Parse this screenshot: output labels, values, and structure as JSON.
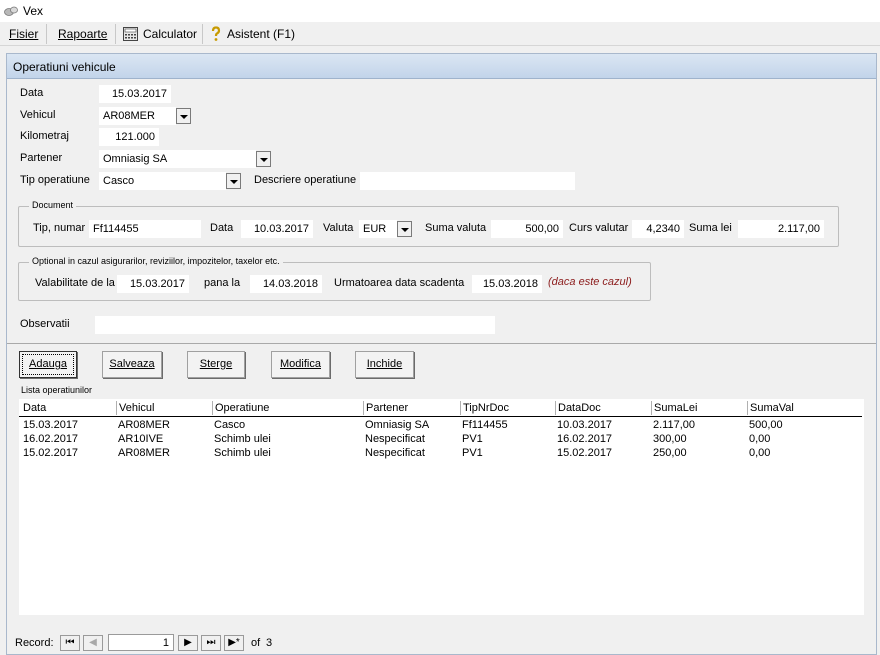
{
  "window": {
    "title": "Vex"
  },
  "menu": {
    "fisier": "Fisier",
    "rapoarte": "Rapoarte",
    "calculator": "Calculator",
    "asistent": "Asistent (F1)"
  },
  "form": {
    "title": "Operatiuni vehicule",
    "data_label": "Data",
    "data_value": "15.03.2017",
    "vehicul_label": "Vehicul",
    "vehicul_value": "AR08MER",
    "kilometraj_label": "Kilometraj",
    "kilometraj_value": "121.000",
    "partener_label": "Partener",
    "partener_value": "Omniasig SA",
    "tip_op_label": "Tip operatiune",
    "tip_op_value": "Casco",
    "descriere_label": "Descriere operatiune",
    "descriere_value": "",
    "observatii_label": "Observatii",
    "observatii_value": ""
  },
  "document": {
    "title": "Document",
    "tip_numar_label": "Tip, numar",
    "tip_numar_value": "Ff114455",
    "data_label": "Data",
    "data_value": "10.03.2017",
    "valuta_label": "Valuta",
    "valuta_value": "EUR",
    "suma_valuta_label": "Suma valuta",
    "suma_valuta_value": "500,00",
    "curs_label": "Curs valutar",
    "curs_value": "4,2340",
    "suma_lei_label": "Suma lei",
    "suma_lei_value": "2.117,00"
  },
  "optional": {
    "title": "Optional in cazul asigurarilor, reviziilor, impozitelor, taxelor etc.",
    "valabil_label": "Valabilitate de la",
    "valabil_value": "15.03.2017",
    "pana_label": "pana la",
    "pana_value": "14.03.2018",
    "scadenta_label": "Urmatoarea data scadenta",
    "scadenta_value": "15.03.2018",
    "hint": "(daca este cazul)"
  },
  "buttons": {
    "adauga": "Adauga",
    "salveaza": "Salveaza",
    "sterge": "Sterge",
    "modifica": "Modifica",
    "inchide": "Inchide"
  },
  "list": {
    "title": "Lista operatiunilor",
    "columns": [
      "Data",
      "Vehicul",
      "Operatiune",
      "Partener",
      "TipNrDoc",
      "DataDoc",
      "SumaLei",
      "SumaVal"
    ],
    "rows": [
      [
        "15.03.2017",
        "AR08MER",
        "Casco",
        "Omniasig SA",
        "Ff114455",
        "10.03.2017",
        "2.117,00",
        "500,00"
      ],
      [
        "16.02.2017",
        "AR10IVE",
        "Schimb ulei",
        "Nespecificat",
        "PV1",
        "16.02.2017",
        "300,00",
        "0,00"
      ],
      [
        "15.02.2017",
        "AR08MER",
        "Schimb ulei",
        "Nespecificat",
        "PV1",
        "15.02.2017",
        "250,00",
        "0,00"
      ]
    ]
  },
  "record_nav": {
    "label": "Record:",
    "current": "1",
    "of_label": "of",
    "total": "3"
  }
}
